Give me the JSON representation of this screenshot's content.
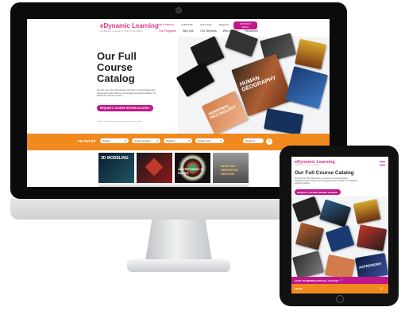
{
  "site": {
    "logo_main": "eDynamic Learning",
    "logo_sub": "CAREER & ELECTIVE COURSES",
    "top_links": [
      "FOR COMMITS",
      "SUPPORT",
      "LET'S ASK",
      "SEARCH"
    ],
    "contact_label": "CONTACT EMAIL",
    "nav": [
      "Our Programs",
      "Why eDL",
      "Our Services",
      "Who We Are",
      "Resources"
    ],
    "hero_title_lines": [
      "Our Full",
      "Course",
      "Catalog"
    ],
    "hero_paragraph": "We offer more than 155 electives, grounded in instructional design, professional audio narration, and engaging interactive activities. No additional textbooks required.",
    "hero_small_note": "*Digital access will be granted once payment has been received.",
    "request_button": "REQUEST COURSE REVIEW ACCESS",
    "filter_label": "FILTER BY",
    "filters": [
      "Subject",
      "Career Clusters",
      "Program",
      "Grade Level"
    ],
    "search_placeholder": "Keyword",
    "thumbnails": [
      "3D MODELING",
      "ADVERTISING & SALES",
      "",
      "AFRICAN AMERICAN HISTORY"
    ],
    "book_titles": [
      "HUMAN GEOGRAPHY",
      "PERSONAL PSYCHOLOGY"
    ]
  },
  "tablet": {
    "logo_main": "eDynamic Learning",
    "logo_sub": "CAREER & ELECTIVE COURSES",
    "title": "Our Full Course Catalog",
    "paragraph": "We offer more than 155 electives, grounded in instructional design, professional audio narration, and engaging interactive activities. No additional textbooks required.",
    "request_button": "REQUEST COURSE REVIEW ACCESS",
    "bottom_bar_label": "CLICK TO BROWSE OUR FULL CATALOG",
    "bottom_bar_sub": "FILTER",
    "book_titles": [
      "ASTRONOMY"
    ]
  },
  "colors": {
    "brand_magenta": "#c0178b",
    "brand_pink": "#e0338a",
    "filter_orange": "#f08a1f"
  }
}
